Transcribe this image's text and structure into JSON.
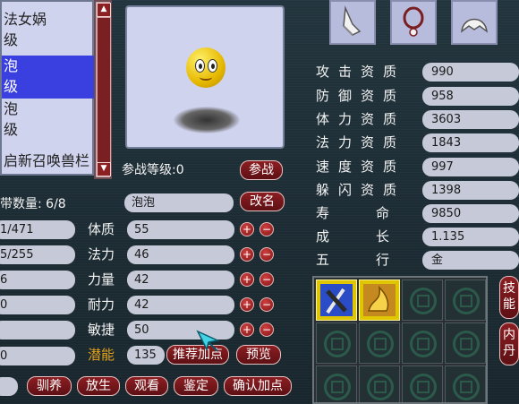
{
  "pet_list": {
    "items": [
      {
        "line1": "法女娲",
        "line2": "级",
        "selected": false
      },
      {
        "line1": "泡",
        "line2": "级",
        "selected": true
      },
      {
        "line1": "泡",
        "line2": "级",
        "selected": false
      }
    ],
    "bottom_text": "启新召唤兽栏"
  },
  "battle": {
    "level_label": "参战等级:0",
    "battle_button": "参战"
  },
  "carry": {
    "label": "带数量: 6/8",
    "name_value": "泡泡",
    "rename_button": "改名"
  },
  "stats_left": {
    "hp": "1/471",
    "mp": "5/255",
    "v3": "6",
    "v4": "0",
    "v5": "",
    "v6": "0"
  },
  "points": [
    {
      "label": "体质",
      "value": "55"
    },
    {
      "label": "法力",
      "value": "46"
    },
    {
      "label": "力量",
      "value": "42"
    },
    {
      "label": "耐力",
      "value": "42"
    },
    {
      "label": "敏捷",
      "value": "50"
    }
  ],
  "potential": {
    "label": "潜能",
    "value": "135"
  },
  "buttons": {
    "recommend": "推荐加点",
    "preview": "预览",
    "tame": "驯养",
    "release": "放生",
    "view": "观看",
    "appraise": "鉴定",
    "confirm": "确认加点",
    "plus": "+",
    "minus": "−"
  },
  "aptitudes": [
    {
      "label": "攻击资质",
      "value": "990"
    },
    {
      "label": "防御资质",
      "value": "958"
    },
    {
      "label": "体力资质",
      "value": "3603"
    },
    {
      "label": "法力资质",
      "value": "1843"
    },
    {
      "label": "速度资质",
      "value": "997"
    },
    {
      "label": "躲闪资质",
      "value": "1398"
    }
  ],
  "special": [
    {
      "label": "寿命",
      "value": "9850"
    },
    {
      "label": "成长",
      "value": "1.135"
    },
    {
      "label": "五行",
      "value": "金"
    }
  ],
  "side_tabs": {
    "skills": "技能",
    "core": "内丹"
  },
  "equipment_icons": [
    "armor-icon",
    "collar-icon",
    "garment-icon"
  ],
  "colors": {
    "accent": "#8c1e22",
    "orange": "#e3a21a",
    "panel": "#cfd3ee"
  }
}
